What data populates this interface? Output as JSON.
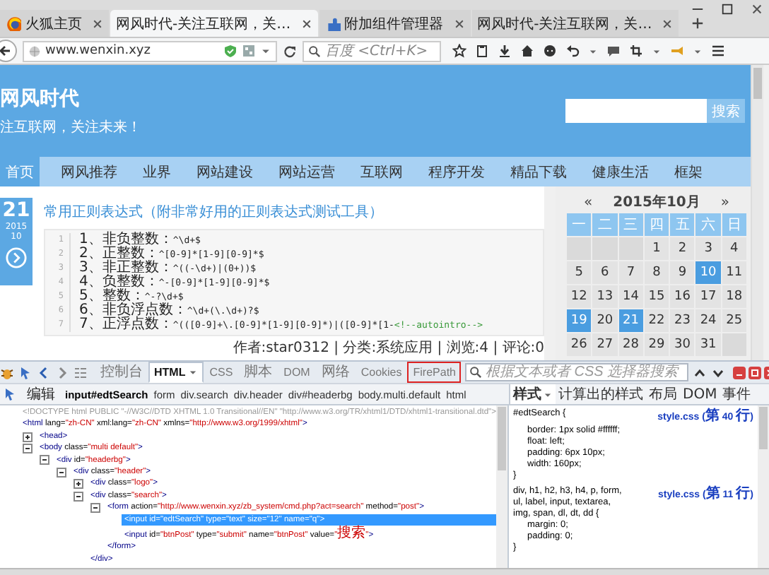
{
  "browser": {
    "tabs": [
      {
        "kind": "firefox",
        "title": "火狐主页",
        "selected": false
      },
      {
        "kind": "page",
        "title": "网风时代-关注互联网，关…",
        "selected": true
      },
      {
        "kind": "addons",
        "title": "附加组件管理器",
        "selected": false
      },
      {
        "kind": "page",
        "title": "网风时代-关注互联网，关…",
        "selected": false
      }
    ],
    "url": "www.wenxin.xyz",
    "search_placeholder": "百度 <Ctrl+K>"
  },
  "site": {
    "title": "网风时代",
    "tagline": "注互联网，关注未来！",
    "search_button": "搜索",
    "nav": [
      {
        "label": "首页",
        "selected": true
      },
      {
        "label": "网风推荐",
        "selected": false
      },
      {
        "label": "业界",
        "selected": false
      },
      {
        "label": "网站建设",
        "selected": false
      },
      {
        "label": "网站运营",
        "selected": false
      },
      {
        "label": "互联网",
        "selected": false
      },
      {
        "label": "程序开发",
        "selected": false
      },
      {
        "label": "精品下载",
        "selected": false
      },
      {
        "label": "健康生活",
        "selected": false
      },
      {
        "label": "框架",
        "selected": false
      }
    ]
  },
  "post": {
    "day": "21",
    "year": "2015",
    "month": "10",
    "title": "常用正则表达式（附非常好用的正则表达式测试工具）",
    "code": [
      {
        "line_number": "1",
        "label": "1、非负整数：",
        "code": "^\\d+$"
      },
      {
        "line_number": "2",
        "label": "2、正整数：",
        "code": "^[0-9]*[1-9][0-9]*$"
      },
      {
        "line_number": "3",
        "label": "3、非正整数：",
        "code": "^((-\\d+)|(0+))$"
      },
      {
        "line_number": "4",
        "label": "4、负整数：",
        "code": "^-[0-9]*[1-9][0-9]*$"
      },
      {
        "line_number": "5",
        "label": "5、整数：",
        "code": "^-?\\d+$"
      },
      {
        "line_number": "6",
        "label": "6、非负浮点数：",
        "code": "^\\d+(\\.\\d+)?$"
      },
      {
        "line_number": "7",
        "label": "7、正浮点数：",
        "code": "^(([0-9]+\\.[0-9]*[1-9][0-9]*)|([0-9]*[1-",
        "comment": "<!--autointro-->"
      }
    ],
    "meta": "作者:star0312 | 分类:系统应用 | 浏览:4 | 评论:0"
  },
  "calendar": {
    "prev": "«",
    "title": "2015年10月",
    "next": "»",
    "weekdays": [
      "一",
      "二",
      "三",
      "四",
      "五",
      "六",
      "日"
    ],
    "weeks": [
      [
        {
          "kind": "blank"
        },
        {
          "kind": "blank"
        },
        {
          "kind": "blank"
        },
        {
          "day": "1",
          "selected": false
        },
        {
          "day": "2",
          "selected": false
        },
        {
          "day": "3",
          "selected": false
        },
        {
          "day": "4",
          "selected": false
        }
      ],
      [
        {
          "day": "5",
          "selected": false
        },
        {
          "day": "6",
          "selected": false
        },
        {
          "day": "7",
          "selected": false
        },
        {
          "day": "8",
          "selected": false
        },
        {
          "day": "9",
          "selected": false
        },
        {
          "day": "10",
          "selected": true
        },
        {
          "day": "11",
          "selected": false
        }
      ],
      [
        {
          "day": "12",
          "selected": false
        },
        {
          "day": "13",
          "selected": false
        },
        {
          "day": "14",
          "selected": false
        },
        {
          "day": "15",
          "selected": false
        },
        {
          "day": "16",
          "selected": false
        },
        {
          "day": "17",
          "selected": false
        },
        {
          "day": "18",
          "selected": false
        }
      ],
      [
        {
          "day": "19",
          "selected": true
        },
        {
          "day": "20",
          "selected": false
        },
        {
          "day": "21",
          "selected": true
        },
        {
          "day": "22",
          "selected": false
        },
        {
          "day": "23",
          "selected": false
        },
        {
          "day": "24",
          "selected": false
        },
        {
          "day": "25",
          "selected": false
        }
      ],
      [
        {
          "day": "26",
          "selected": false
        },
        {
          "day": "27",
          "selected": false
        },
        {
          "day": "28",
          "selected": false
        },
        {
          "day": "29",
          "selected": false
        },
        {
          "day": "30",
          "selected": false
        },
        {
          "day": "31",
          "selected": false
        },
        {
          "kind": "blank"
        }
      ]
    ]
  },
  "firebug": {
    "tabs": [
      {
        "label": "控制台",
        "selected": false,
        "dropdown": false,
        "outlined": false
      },
      {
        "label": "HTML",
        "selected": true,
        "dropdown": true,
        "outlined": false
      },
      {
        "label": "CSS",
        "selected": false,
        "dropdown": false,
        "outlined": false
      },
      {
        "label": "脚本",
        "selected": false,
        "dropdown": false,
        "outlined": false
      },
      {
        "label": "DOM",
        "selected": false,
        "dropdown": false,
        "outlined": false
      },
      {
        "label": "网络",
        "selected": false,
        "dropdown": false,
        "outlined": false
      },
      {
        "label": "Cookies",
        "selected": false,
        "dropdown": false,
        "outlined": false
      },
      {
        "label": "FirePath",
        "selected": false,
        "dropdown": false,
        "outlined": true
      }
    ],
    "search_placeholder": "根据文本或者 CSS 选择器搜索",
    "edit_button": "编辑",
    "breadcrumb": [
      {
        "label": "input#edtSearch",
        "selected": true
      },
      {
        "label": "form",
        "selected": false
      },
      {
        "label": "div.search",
        "selected": false
      },
      {
        "label": "div.header",
        "selected": false
      },
      {
        "label": "div#headerbg",
        "selected": false
      },
      {
        "label": "body.multi.default",
        "selected": false
      },
      {
        "label": "html",
        "selected": false
      }
    ],
    "side_tabs": [
      {
        "label": "样式",
        "selected": true,
        "dropdown": true
      },
      {
        "label": "计算出的样式",
        "selected": false,
        "dropdown": false
      },
      {
        "label": "布局",
        "selected": false,
        "dropdown": false
      },
      {
        "label": "DOM",
        "selected": false,
        "dropdown": false
      },
      {
        "label": "事件",
        "selected": false,
        "dropdown": false
      }
    ],
    "html_tree": [
      {
        "kind": "doctype",
        "selected": false,
        "text": "<!DOCTYPE html PUBLIC \"-//W3C//DTD XHTML 1.0 Transitional//EN\" \"http://www.w3.org/TR/xhtml1/DTD/xhtml1-transitional.dtd\">"
      },
      {
        "kind": "element",
        "selected": false,
        "text": "<html lang=\"zh-CN\" xml:lang=\"zh-CN\" xmlns=\"http://www.w3.org/1999/xhtml\">",
        "children": [
          {
            "kind": "element",
            "selected": false,
            "expanded": false,
            "text": "<head>"
          },
          {
            "kind": "element",
            "selected": false,
            "expanded": true,
            "text": "<body class=\"multi default\">",
            "children": [
              {
                "kind": "element",
                "selected": false,
                "expanded": true,
                "text": "<div id=\"headerbg\">",
                "children": [
                  {
                    "kind": "element",
                    "selected": false,
                    "expanded": true,
                    "text": "<div class=\"header\">",
                    "children": [
                      {
                        "kind": "element",
                        "selected": false,
                        "expanded": false,
                        "text": "<div class=\"logo\">"
                      },
                      {
                        "kind": "element",
                        "selected": false,
                        "expanded": true,
                        "text": "<div class=\"search\">",
                        "close": "</div>",
                        "children": [
                          {
                            "kind": "element",
                            "selected": false,
                            "expanded": true,
                            "text": "<form action=\"http://www.wenxin.xyz/zb_system/cmd.php?act=search\" method=\"post\">",
                            "close": "</form>",
                            "children": [
                              {
                                "kind": "element",
                                "selected": true,
                                "text": "<input id=\"edtSearch\" type=\"text\" size=\"12\" name=\"q\">"
                              },
                              {
                                "kind": "element",
                                "selected": false,
                                "text": "<input id=\"btnPost\" type=\"submit\" name=\"btnPost\" value=\"搜索\">"
                              }
                            ]
                          }
                        ]
                      }
                    ]
                  }
                ]
              }
            ]
          }
        ]
      }
    ],
    "css_rules": [
      {
        "selector": "#edtSearch {",
        "source": "style.css (第 40 行)",
        "props": [
          "border: 1px solid #ffffff;",
          "float: left;",
          "padding: 6px 10px;",
          "width: 160px;"
        ],
        "close": "}"
      },
      {
        "selector": "div, h1, h2, h3, h4, p, form, ul, label, input, textarea, img, span, dl, dt, dd {",
        "source": "style.css (第 11 行)",
        "props": [
          "margin: 0;",
          "padding: 0;"
        ],
        "close": "}"
      }
    ]
  }
}
